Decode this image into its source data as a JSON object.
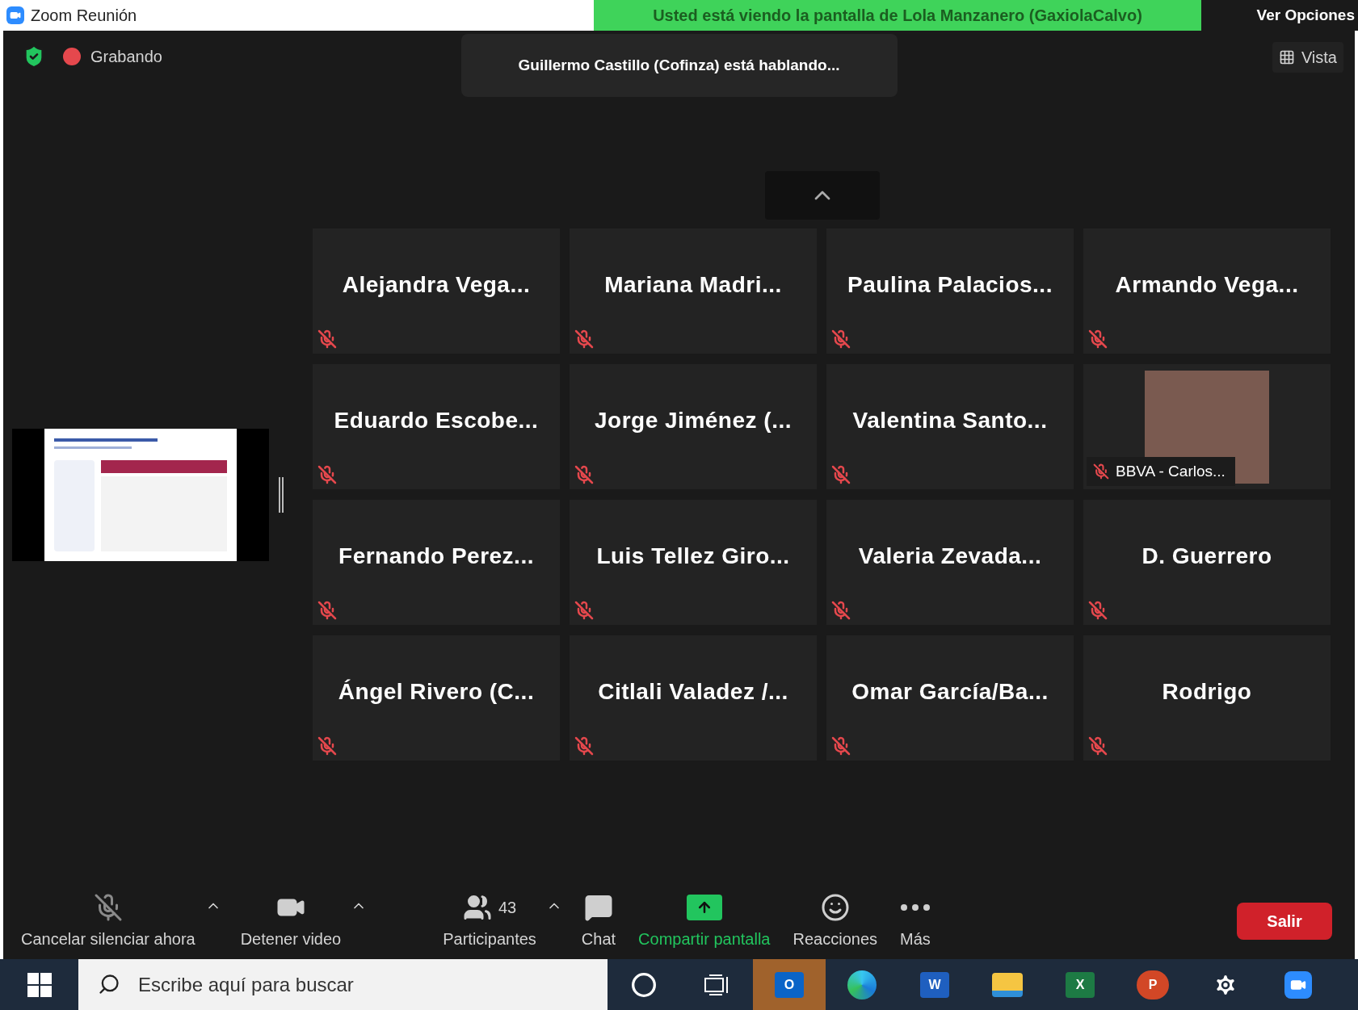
{
  "window": {
    "title": "Zoom Reunión"
  },
  "share_banner": {
    "text": "Usted está viendo la pantalla de Lola Manzanero (GaxiolaCalvo)",
    "view_options": "Ver Opciones"
  },
  "top_bar": {
    "secure": true,
    "recording": "Grabando",
    "speaking": "Guillermo Castillo (Cofinza) está hablando...",
    "view_button": "Vista"
  },
  "participants": [
    {
      "kind": "name",
      "name": "Alejandra Vega...",
      "muted": true
    },
    {
      "kind": "name",
      "name": "Mariana Madri...",
      "muted": true
    },
    {
      "kind": "name",
      "name": "Paulina Palacios...",
      "muted": true
    },
    {
      "kind": "name",
      "name": "Armando Vega...",
      "muted": true
    },
    {
      "kind": "name",
      "name": "Eduardo Escobe...",
      "muted": true
    },
    {
      "kind": "name",
      "name": "Jorge Jiménez (...",
      "muted": true
    },
    {
      "kind": "name",
      "name": "Valentina Santo...",
      "muted": true
    },
    {
      "kind": "photo",
      "name": "BBVA - Carlos...",
      "muted": true
    },
    {
      "kind": "name",
      "name": "Fernando Perez...",
      "muted": true
    },
    {
      "kind": "name",
      "name": "Luis Tellez Giro...",
      "muted": true
    },
    {
      "kind": "name",
      "name": "Valeria Zevada...",
      "muted": true
    },
    {
      "kind": "name",
      "name": "D. Guerrero",
      "muted": true
    },
    {
      "kind": "name",
      "name": "Ángel Rivero (C...",
      "muted": true
    },
    {
      "kind": "name",
      "name": "Citlali Valadez /...",
      "muted": true
    },
    {
      "kind": "name",
      "name": "Omar García/Ba...",
      "muted": true
    },
    {
      "kind": "name",
      "name": "Rodrigo",
      "muted": true
    }
  ],
  "toolbar": [
    {
      "kind": "mic",
      "label": "Cancelar silenciar ahora",
      "caret": true
    },
    {
      "kind": "video",
      "label": "Detener video",
      "caret": true
    },
    {
      "kind": "participants",
      "label": "Participantes",
      "count": "43",
      "caret": true
    },
    {
      "kind": "chat",
      "label": "Chat",
      "caret": false
    },
    {
      "kind": "share",
      "label": "Compartir pantalla",
      "caret": false
    },
    {
      "kind": "reactions",
      "label": "Reacciones",
      "caret": false
    },
    {
      "kind": "more",
      "label": "Más",
      "caret": false
    }
  ],
  "leave_button": "Salir",
  "taskbar": {
    "search_placeholder": "Escribe aquí para buscar",
    "apps": [
      {
        "kind": "outlook",
        "glyph": "O",
        "selected": true
      },
      {
        "kind": "edge",
        "selected": false
      },
      {
        "kind": "word",
        "glyph": "W",
        "selected": false
      },
      {
        "kind": "explorer",
        "selected": false
      },
      {
        "kind": "excel",
        "glyph": "X",
        "selected": false
      },
      {
        "kind": "powerpoint",
        "glyph": "P",
        "selected": false
      },
      {
        "kind": "settings",
        "selected": false
      },
      {
        "kind": "zoom",
        "selected": false
      }
    ]
  }
}
